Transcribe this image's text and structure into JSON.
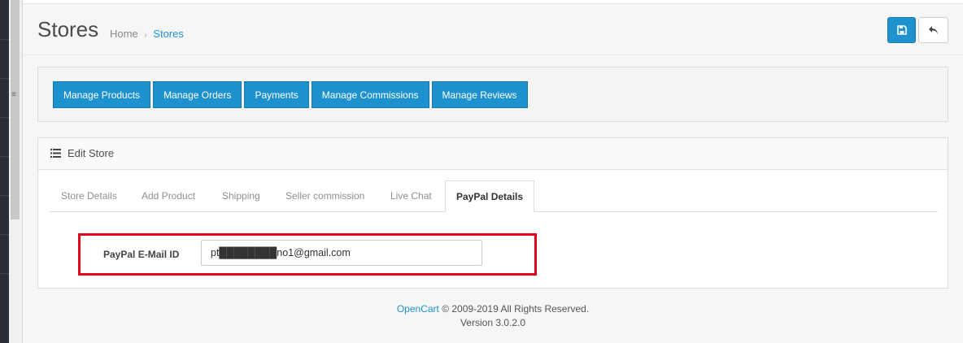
{
  "header": {
    "title": "Stores",
    "breadcrumb": {
      "home": "Home",
      "current": "Stores",
      "separator": "›"
    }
  },
  "actions": {
    "save_icon": "save-icon",
    "back_icon": "reply-icon"
  },
  "toolbar": {
    "buttons": [
      "Manage Products",
      "Manage Orders",
      "Payments",
      "Manage Commissions",
      "Manage Reviews"
    ]
  },
  "panel": {
    "title": "Edit Store",
    "tabs": [
      "Store Details",
      "Add Product",
      "Shipping",
      "Seller commission",
      "Live Chat",
      "PayPal Details"
    ],
    "active_tab": "PayPal Details"
  },
  "form": {
    "label": "PayPal E-Mail ID",
    "value": "pt████████no1@gmail.com"
  },
  "footer": {
    "link": "OpenCart",
    "copyright": "© 2009-2019 All Rights Reserved.",
    "version": "Version 3.0.2.0"
  },
  "colors": {
    "primary": "#1e91cf",
    "highlight": "#e2001a"
  }
}
